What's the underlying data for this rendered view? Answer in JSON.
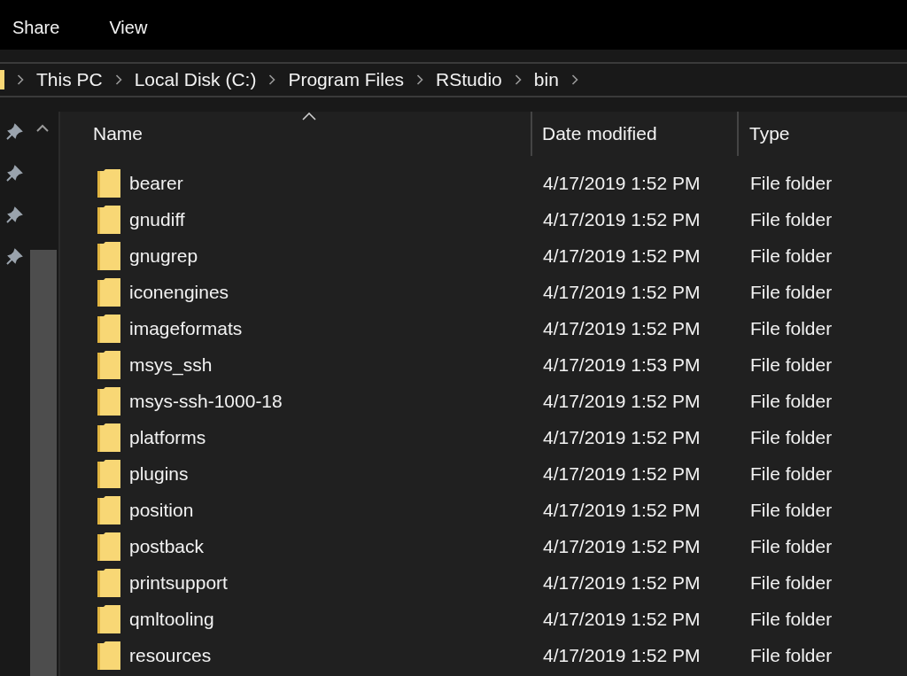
{
  "ribbon_tabs": [
    "Share",
    "View"
  ],
  "breadcrumb": [
    "This PC",
    "Local Disk (C:)",
    "Program Files",
    "RStudio",
    "bin"
  ],
  "table": {
    "columns": [
      "Name",
      "Date modified",
      "Type"
    ],
    "rows": [
      {
        "name": "bearer",
        "date": "4/17/2019 1:52 PM",
        "type": "File folder"
      },
      {
        "name": "gnudiff",
        "date": "4/17/2019 1:52 PM",
        "type": "File folder"
      },
      {
        "name": "gnugrep",
        "date": "4/17/2019 1:52 PM",
        "type": "File folder"
      },
      {
        "name": "iconengines",
        "date": "4/17/2019 1:52 PM",
        "type": "File folder"
      },
      {
        "name": "imageformats",
        "date": "4/17/2019 1:52 PM",
        "type": "File folder"
      },
      {
        "name": "msys_ssh",
        "date": "4/17/2019 1:53 PM",
        "type": "File folder"
      },
      {
        "name": "msys-ssh-1000-18",
        "date": "4/17/2019 1:52 PM",
        "type": "File folder"
      },
      {
        "name": "platforms",
        "date": "4/17/2019 1:52 PM",
        "type": "File folder"
      },
      {
        "name": "plugins",
        "date": "4/17/2019 1:52 PM",
        "type": "File folder"
      },
      {
        "name": "position",
        "date": "4/17/2019 1:52 PM",
        "type": "File folder"
      },
      {
        "name": "postback",
        "date": "4/17/2019 1:52 PM",
        "type": "File folder"
      },
      {
        "name": "printsupport",
        "date": "4/17/2019 1:52 PM",
        "type": "File folder"
      },
      {
        "name": "qmltooling",
        "date": "4/17/2019 1:52 PM",
        "type": "File folder"
      },
      {
        "name": "resources",
        "date": "4/17/2019 1:52 PM",
        "type": "File folder"
      }
    ]
  }
}
